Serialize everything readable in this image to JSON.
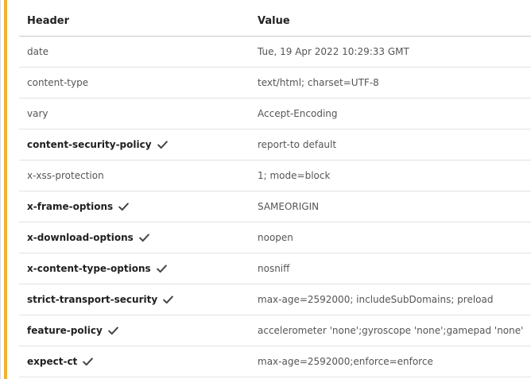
{
  "colors": {
    "accent": "#f0b232",
    "check": "#444444"
  },
  "table": {
    "header_label": "Header",
    "value_label": "Value",
    "rows": [
      {
        "name": "date",
        "value": "Tue, 19 Apr 2022 10:29:33 GMT",
        "flagged": false
      },
      {
        "name": "content-type",
        "value": "text/html; charset=UTF-8",
        "flagged": false
      },
      {
        "name": "vary",
        "value": "Accept-Encoding",
        "flagged": false
      },
      {
        "name": "content-security-policy",
        "value": "report-to default",
        "flagged": true
      },
      {
        "name": "x-xss-protection",
        "value": "1; mode=block",
        "flagged": false
      },
      {
        "name": "x-frame-options",
        "value": "SAMEORIGIN",
        "flagged": true
      },
      {
        "name": "x-download-options",
        "value": "noopen",
        "flagged": true
      },
      {
        "name": "x-content-type-options",
        "value": "nosniff",
        "flagged": true
      },
      {
        "name": "strict-transport-security",
        "value": "max-age=2592000; includeSubDomains; preload",
        "flagged": true
      },
      {
        "name": "feature-policy",
        "value": "accelerometer 'none';gyroscope 'none';gamepad 'none'",
        "flagged": true
      },
      {
        "name": "expect-ct",
        "value": "max-age=2592000;enforce=enforce",
        "flagged": true
      }
    ]
  }
}
